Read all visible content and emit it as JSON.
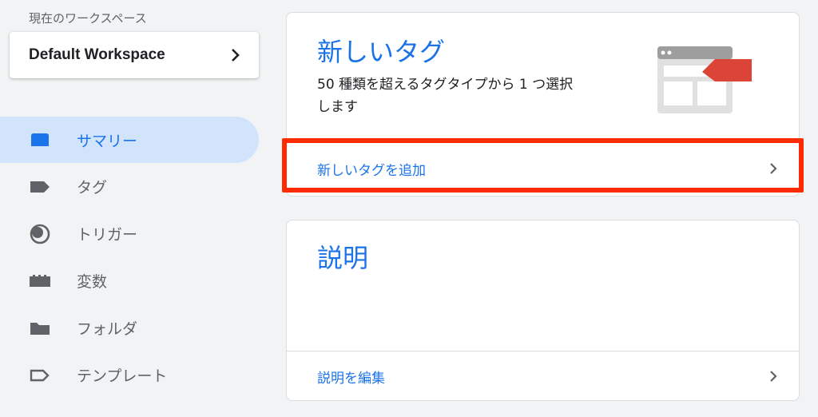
{
  "sidebar": {
    "workspace_caption": "現在のワークスペース",
    "workspace_name": "Default Workspace",
    "items": [
      {
        "label": "サマリー",
        "icon": "summary-icon",
        "active": true
      },
      {
        "label": "タグ",
        "icon": "tag-icon",
        "active": false
      },
      {
        "label": "トリガー",
        "icon": "trigger-icon",
        "active": false
      },
      {
        "label": "変数",
        "icon": "variables-icon",
        "active": false
      },
      {
        "label": "フォルダ",
        "icon": "folder-icon",
        "active": false
      },
      {
        "label": "テンプレート",
        "icon": "template-icon",
        "active": false
      }
    ]
  },
  "new_tag_card": {
    "title": "新しいタグ",
    "description": "50 種類を超えるタグタイプから 1 つ選択します",
    "action_label": "新しいタグを追加"
  },
  "description_card": {
    "title": "説明",
    "action_label": "説明を編集"
  },
  "colors": {
    "accent": "#1a73e8",
    "active_nav_bg": "#d2e3fc",
    "highlight": "#ff2a00",
    "tag_red": "#db4437"
  }
}
